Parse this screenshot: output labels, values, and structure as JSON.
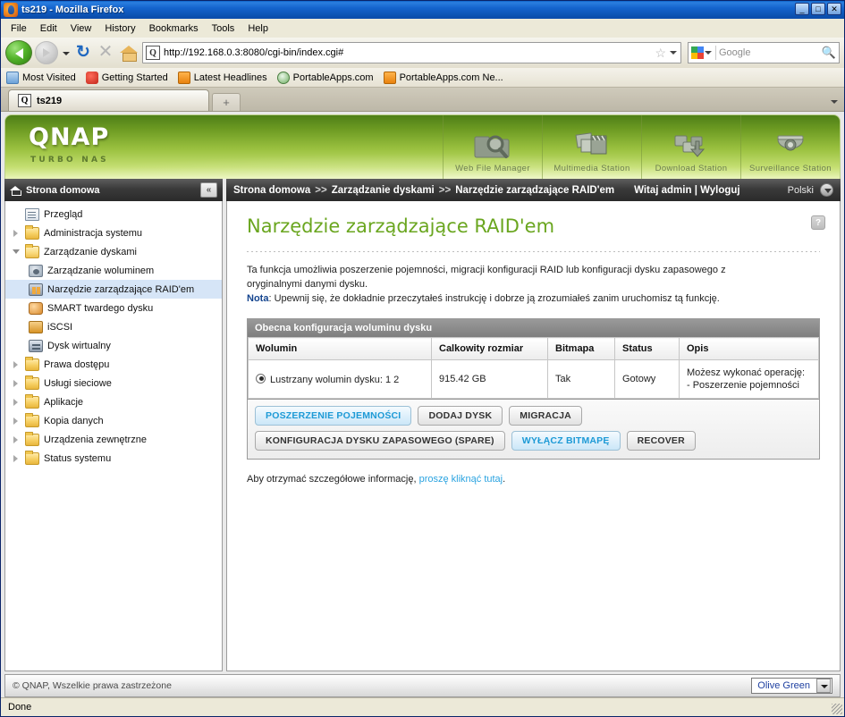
{
  "browser": {
    "window_title": "ts219 - Mozilla Firefox",
    "menus": [
      "File",
      "Edit",
      "View",
      "History",
      "Bookmarks",
      "Tools",
      "Help"
    ],
    "url": "http://192.168.0.3:8080/cgi-bin/index.cgi#",
    "search_placeholder": "Google",
    "bookmarks": [
      {
        "label": "Most Visited",
        "icon": "globe-icon"
      },
      {
        "label": "Getting Started",
        "icon": "firefox-icon"
      },
      {
        "label": "Latest Headlines",
        "icon": "rss-icon"
      },
      {
        "label": "PortableApps.com",
        "icon": "portableapps-icon"
      },
      {
        "label": "PortableApps.com Ne...",
        "icon": "rss-icon"
      }
    ],
    "tab_title": "ts219",
    "new_tab_label": "+",
    "status_text": "Done",
    "win_minimize": "_",
    "win_maximize": "□",
    "win_close": "✕"
  },
  "banner": {
    "logo": "QNAP",
    "tagline": "TURBO NAS",
    "apps": [
      {
        "label": "Web File Manager",
        "icon": "folder-magnifier-icon"
      },
      {
        "label": "Multimedia Station",
        "icon": "photos-clapper-icon"
      },
      {
        "label": "Download Station",
        "icon": "download-arrow-icon"
      },
      {
        "label": "Surveillance Station",
        "icon": "dome-camera-icon"
      }
    ]
  },
  "sidebar": {
    "header": "Strona domowa",
    "collapse_label": "«",
    "items": [
      {
        "label": "Przegląd",
        "icon": "overview-doc-icon",
        "level": 0,
        "twisty": "none",
        "selected": false
      },
      {
        "label": "Administracja systemu",
        "icon": "folder-icon",
        "level": 0,
        "twisty": "closed",
        "selected": false
      },
      {
        "label": "Zarządzanie dyskami",
        "icon": "folder-open-icon",
        "level": 0,
        "twisty": "open",
        "selected": false
      },
      {
        "label": "Zarządzanie woluminem",
        "icon": "volume-disk-icon",
        "level": 1,
        "twisty": "none",
        "selected": false
      },
      {
        "label": "Narzędzie zarządzające RAID'em",
        "icon": "raid-icon",
        "level": 1,
        "twisty": "none",
        "selected": true
      },
      {
        "label": "SMART twardego dysku",
        "icon": "smart-disk-icon",
        "level": 1,
        "twisty": "none",
        "selected": false
      },
      {
        "label": "iSCSI",
        "icon": "iscsi-icon",
        "level": 1,
        "twisty": "none",
        "selected": false
      },
      {
        "label": "Dysk wirtualny",
        "icon": "virtual-disk-icon",
        "level": 1,
        "twisty": "none",
        "selected": false
      },
      {
        "label": "Prawa dostępu",
        "icon": "folder-icon",
        "level": 0,
        "twisty": "closed",
        "selected": false
      },
      {
        "label": "Usługi sieciowe",
        "icon": "folder-icon",
        "level": 0,
        "twisty": "closed",
        "selected": false
      },
      {
        "label": "Aplikacje",
        "icon": "folder-icon",
        "level": 0,
        "twisty": "closed",
        "selected": false
      },
      {
        "label": "Kopia danych",
        "icon": "folder-icon",
        "level": 0,
        "twisty": "closed",
        "selected": false
      },
      {
        "label": "Urządzenia zewnętrzne",
        "icon": "folder-icon",
        "level": 0,
        "twisty": "closed",
        "selected": false
      },
      {
        "label": "Status systemu",
        "icon": "folder-icon",
        "level": 0,
        "twisty": "closed",
        "selected": false
      }
    ]
  },
  "topbar": {
    "breadcrumb": [
      "Strona domowa",
      "Zarządzanie dyskami",
      "Narzędzie zarządzające RAID'em"
    ],
    "separator": ">>",
    "welcome": "Witaj admin | Wyloguj",
    "language": "Polski"
  },
  "main": {
    "title": "Narzędzie zarządzające RAID'em",
    "help_label": "?",
    "description_line1": "Ta funkcja umożliwia poszerzenie pojemności, migracji konfiguracji RAID lub konfiguracji dysku zapasowego z",
    "description_line2": "oryginalnymi danymi dysku.",
    "note_label": "Nota",
    "note_text": ": Upewnij się, że dokładnie przeczytałeś instrukcję i dobrze ją zrozumiałeś zanim uruchomisz tą funkcję.",
    "table": {
      "caption": "Obecna konfiguracja woluminu dysku",
      "headers": [
        "Wolumin",
        "Calkowity rozmiar",
        "Bitmapa",
        "Status",
        "Opis"
      ],
      "rows": [
        {
          "volume": "Lustrzany wolumin dysku: 1 2",
          "total_size": "915.42 GB",
          "bitmap": "Tak",
          "status": "Gotowy",
          "description_line1": "Możesz wykonać operację:",
          "description_line2": "- Poszerzenie pojemności",
          "selected": true
        }
      ]
    },
    "buttons_row1": [
      {
        "label": "POSZERZENIE POJEMNOŚCI",
        "active": true
      },
      {
        "label": "DODAJ DYSK",
        "active": false
      },
      {
        "label": "MIGRACJA",
        "active": false
      }
    ],
    "buttons_row2": [
      {
        "label": "KONFIGURACJA DYSKU ZAPASOWEGO (SPARE)",
        "active": false
      },
      {
        "label": "WYŁĄCZ BITMAPĘ",
        "active": true
      },
      {
        "label": "RECOVER",
        "active": false
      }
    ],
    "hint_prefix": "Aby otrzymać szczegółowe informację, ",
    "hint_link": "proszę kliknąć tutaj",
    "hint_suffix": "."
  },
  "footer": {
    "copyright": "© QNAP, Wszelkie prawa zastrzeżone",
    "theme": "Olive Green"
  },
  "colors": {
    "brand_green": "#6aa61f",
    "banner_top": "#4e7f18",
    "banner_bottom": "#eaf5b9",
    "active_button_text": "#1d9ad6",
    "link": "#2aa3e0",
    "selection": "#d6e5f7"
  }
}
